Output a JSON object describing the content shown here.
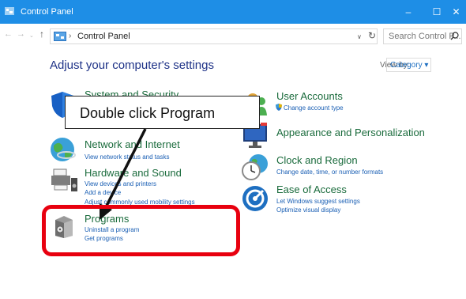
{
  "window": {
    "title": "Control Panel",
    "controls": {
      "minimize": "–",
      "maximize": "☐",
      "close": "✕"
    }
  },
  "nav": {
    "back": "←",
    "forward": "→",
    "recent": "⌄",
    "up": "↑"
  },
  "address": {
    "separator": "›",
    "crumb": "Control Panel",
    "dropdown": "∨",
    "refresh": "↻"
  },
  "search": {
    "placeholder": "Search Control P..."
  },
  "main": {
    "heading": "Adjust your computer's settings",
    "view_by_label": "View by:",
    "view_by_value": "Category ▾"
  },
  "categories_left": [
    {
      "title": "System and Security",
      "links": []
    },
    {
      "title": "Network and Internet",
      "links": [
        "View network status and tasks"
      ]
    },
    {
      "title": "Hardware and Sound",
      "links": [
        "View devices and printers",
        "Add a device",
        "Adjust commonly used mobility settings"
      ]
    },
    {
      "title": "Programs",
      "links": [
        "Uninstall a program",
        "Get programs"
      ]
    }
  ],
  "categories_right": [
    {
      "title": "User Accounts",
      "links": [
        "Change account type"
      ]
    },
    {
      "title": "Appearance and Personalization",
      "links": []
    },
    {
      "title": "Clock and Region",
      "links": [
        "Change date, time, or number formats"
      ]
    },
    {
      "title": "Ease of Access",
      "links": [
        "Let Windows suggest settings",
        "Optimize visual display"
      ]
    }
  ],
  "annotation": {
    "callout_text": "Double click Program",
    "highlight_color": "#e8000f"
  },
  "colors": {
    "titlebar": "#1e8ee6",
    "category_title": "#1a6b3c",
    "link": "#1a5fb4",
    "heading": "#1e3287"
  }
}
